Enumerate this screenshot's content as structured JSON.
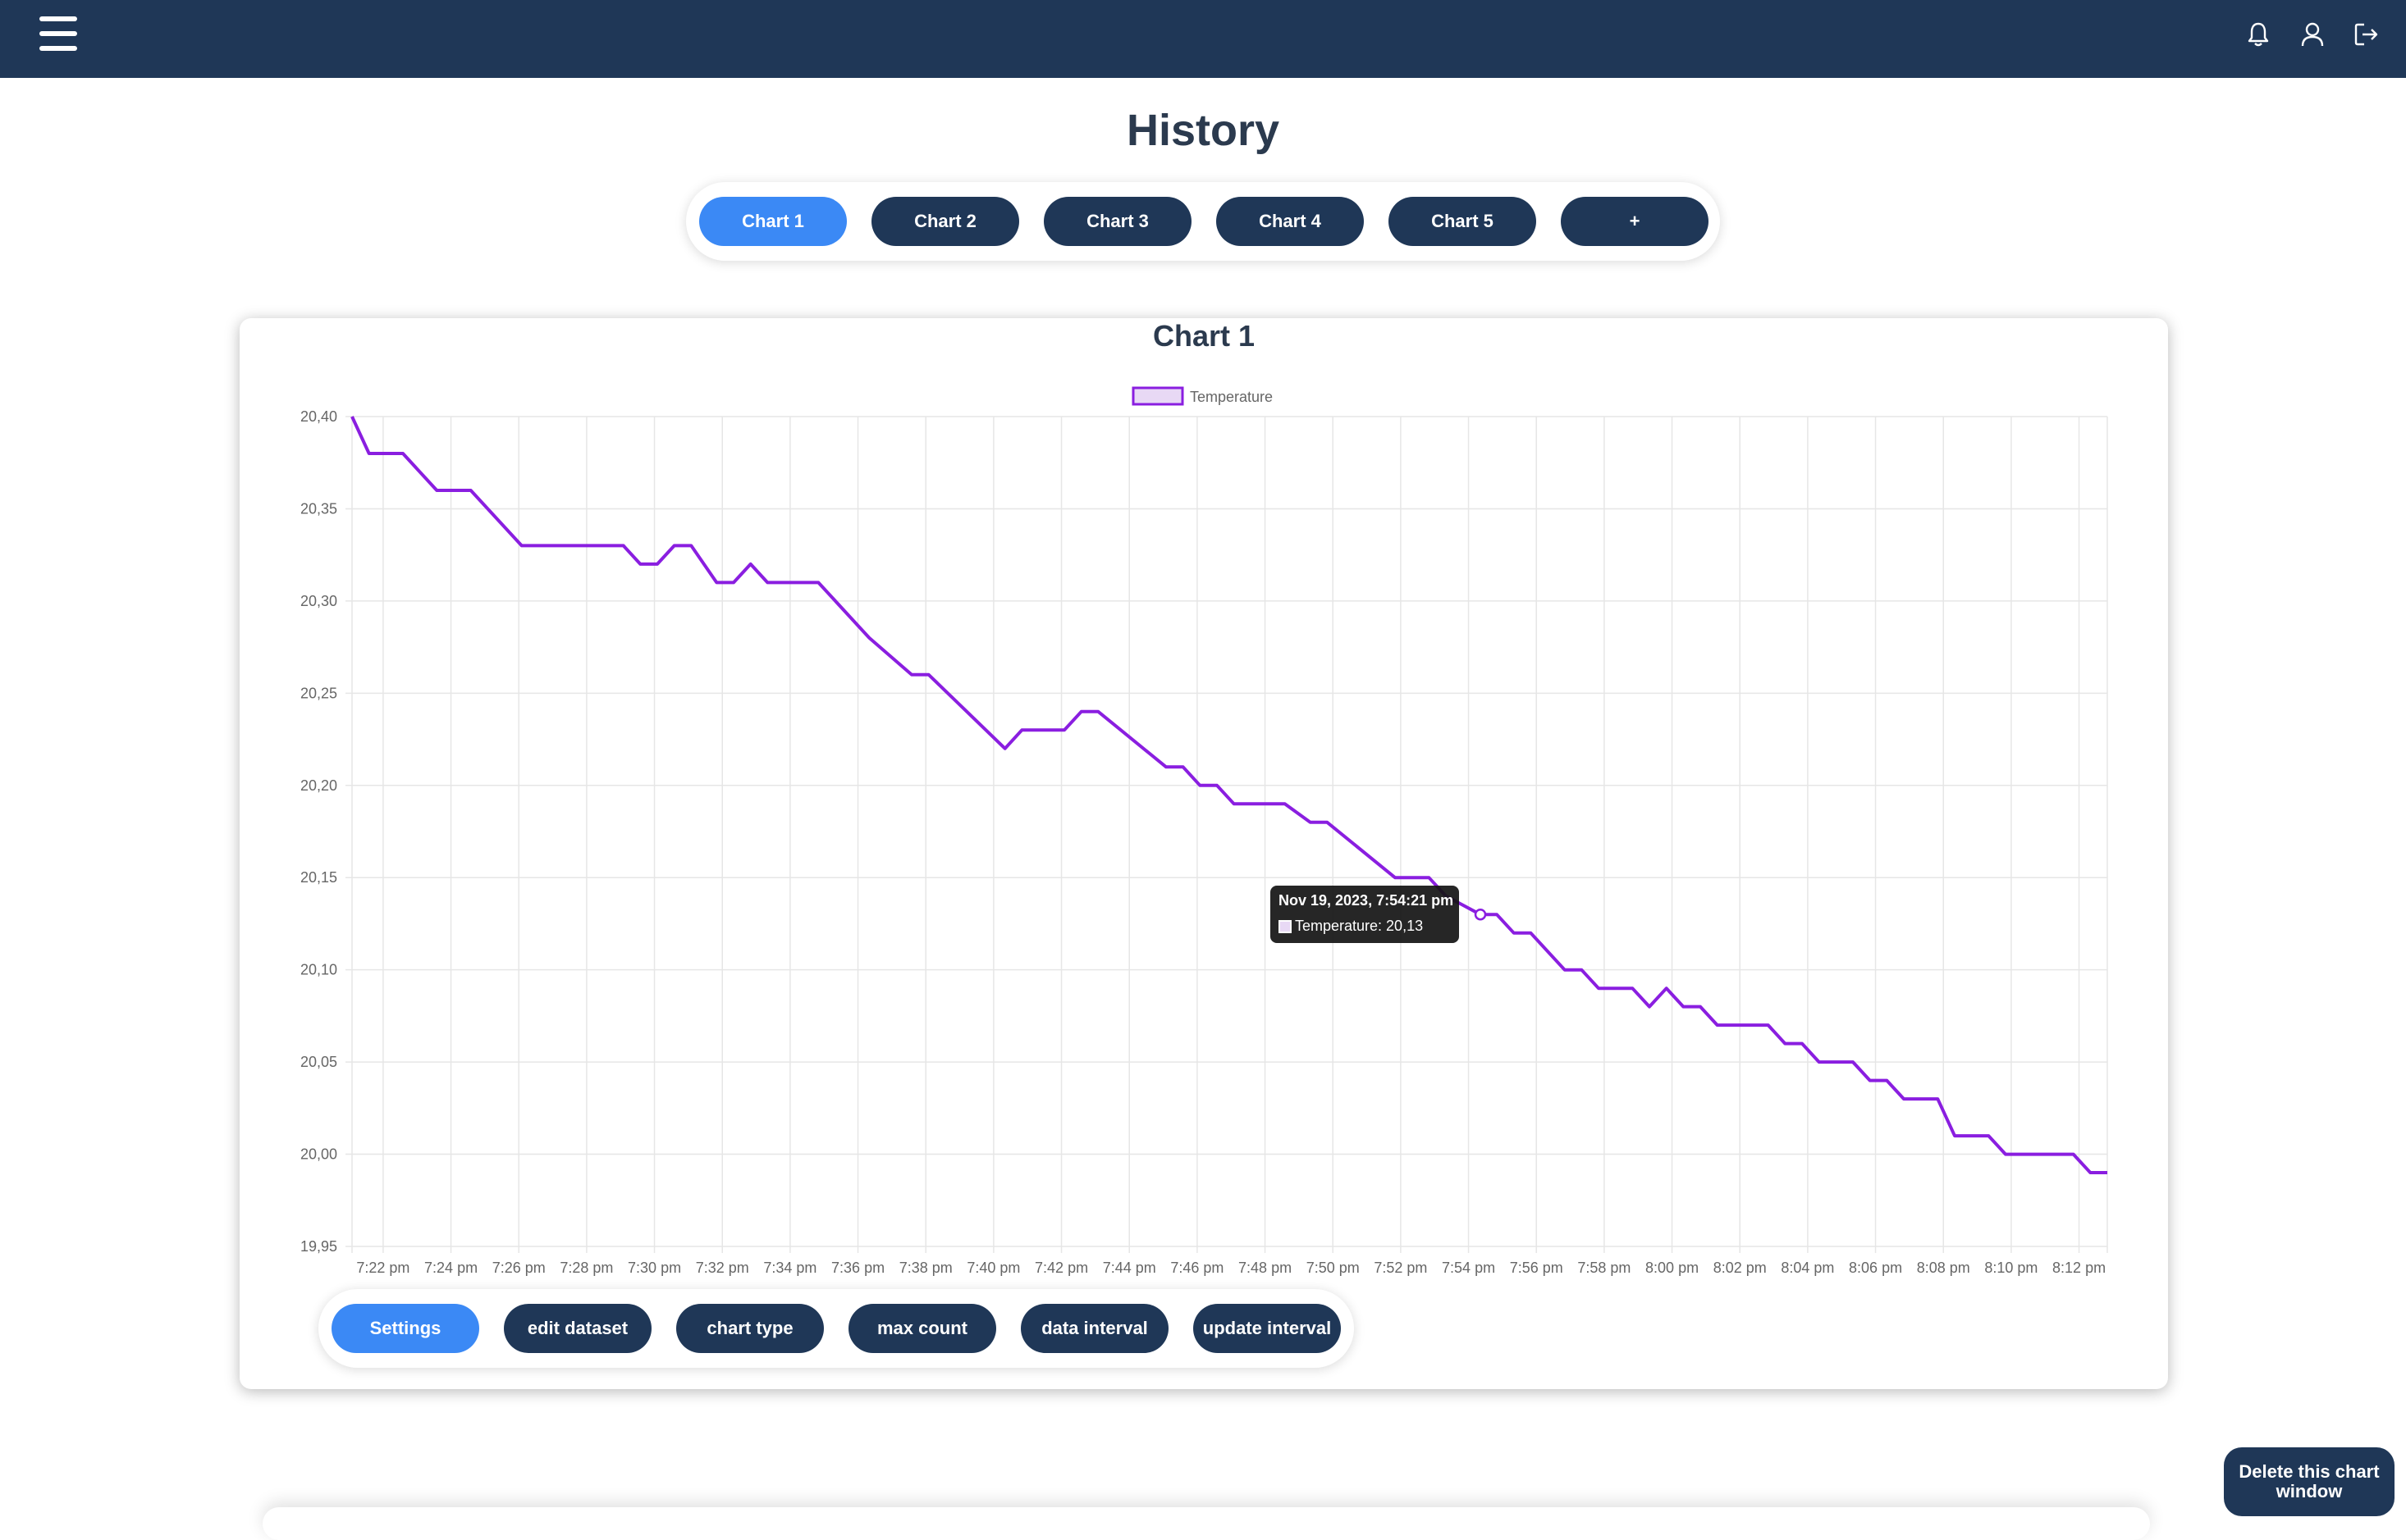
{
  "header": {
    "menu_icon": "hamburger-icon",
    "icons": [
      "bell-icon",
      "user-icon",
      "logout-icon"
    ]
  },
  "page": {
    "title": "History"
  },
  "tabs": [
    {
      "label": "Chart 1",
      "active": true
    },
    {
      "label": "Chart 2",
      "active": false
    },
    {
      "label": "Chart 3",
      "active": false
    },
    {
      "label": "Chart 4",
      "active": false
    },
    {
      "label": "Chart 5",
      "active": false
    },
    {
      "label": "+",
      "active": false
    }
  ],
  "card": {
    "title": "Chart 1"
  },
  "tooltip": {
    "title": "Nov 19, 2023, 7:54:21 pm",
    "label": "Temperature: 20,13"
  },
  "settings": [
    {
      "label": "Settings",
      "active": true
    },
    {
      "label": "edit dataset",
      "active": false
    },
    {
      "label": "chart type",
      "active": false
    },
    {
      "label": "max count",
      "active": false
    },
    {
      "label": "data interval",
      "active": false
    },
    {
      "label": "update interval",
      "active": false
    }
  ],
  "actions": {
    "delete_label": "Delete this chart window"
  },
  "colors": {
    "navy": "#1f3757",
    "accent": "#3b89f5",
    "line": "#8a1ee0"
  },
  "chart_data": {
    "type": "line",
    "title": "Chart 1",
    "legend": {
      "position": "top",
      "entries": [
        "Temperature"
      ]
    },
    "ylim": [
      19.95,
      20.4
    ],
    "yticks": [
      "20,40",
      "20,35",
      "20,30",
      "20,25",
      "20,20",
      "20,15",
      "20,10",
      "20,05",
      "20,00",
      "19,95"
    ],
    "xticks": [
      "7:22 pm",
      "7:24 pm",
      "7:26 pm",
      "7:28 pm",
      "7:30 pm",
      "7:32 pm",
      "7:34 pm",
      "7:36 pm",
      "7:38 pm",
      "7:40 pm",
      "7:42 pm",
      "7:44 pm",
      "7:46 pm",
      "7:48 pm",
      "7:50 pm",
      "7:52 pm",
      "7:54 pm",
      "7:56 pm",
      "7:58 pm",
      "8:00 pm",
      "8:02 pm",
      "8:04 pm",
      "8:06 pm",
      "8:08 pm",
      "8:10 pm",
      "8:12 pm"
    ],
    "grid": true,
    "series": [
      {
        "name": "Temperature",
        "color": "#8a1ee0",
        "points": [
          [
            "7:21:05 pm",
            20.4
          ],
          [
            "7:21:35 pm",
            20.38
          ],
          [
            "7:22:35 pm",
            20.38
          ],
          [
            "7:23:35 pm",
            20.36
          ],
          [
            "7:24:35 pm",
            20.36
          ],
          [
            "7:26:05 pm",
            20.33
          ],
          [
            "7:29:05 pm",
            20.33
          ],
          [
            "7:29:35 pm",
            20.32
          ],
          [
            "7:30:05 pm",
            20.32
          ],
          [
            "7:30:35 pm",
            20.33
          ],
          [
            "7:31:05 pm",
            20.33
          ],
          [
            "7:31:50 pm",
            20.31
          ],
          [
            "7:32:20 pm",
            20.31
          ],
          [
            "7:32:50 pm",
            20.32
          ],
          [
            "7:33:20 pm",
            20.31
          ],
          [
            "7:34:50 pm",
            20.31
          ],
          [
            "7:36:20 pm",
            20.28
          ],
          [
            "7:37:35 pm",
            20.26
          ],
          [
            "7:38:05 pm",
            20.26
          ],
          [
            "7:40:20 pm",
            20.22
          ],
          [
            "7:40:50 pm",
            20.23
          ],
          [
            "7:42:05 pm",
            20.23
          ],
          [
            "7:42:35 pm",
            20.24
          ],
          [
            "7:43:05 pm",
            20.24
          ],
          [
            "7:45:05 pm",
            20.21
          ],
          [
            "7:45:35 pm",
            20.21
          ],
          [
            "7:46:05 pm",
            20.2
          ],
          [
            "7:46:35 pm",
            20.2
          ],
          [
            "7:47:05 pm",
            20.19
          ],
          [
            "7:48:35 pm",
            20.19
          ],
          [
            "7:49:20 pm",
            20.18
          ],
          [
            "7:49:50 pm",
            20.18
          ],
          [
            "7:51:50 pm",
            20.15
          ],
          [
            "7:52:50 pm",
            20.15
          ],
          [
            "7:53:20 pm",
            20.14
          ],
          [
            "7:54:21 pm",
            20.13
          ],
          [
            "7:54:50 pm",
            20.13
          ],
          [
            "7:55:20 pm",
            20.12
          ],
          [
            "7:55:50 pm",
            20.12
          ],
          [
            "7:56:50 pm",
            20.1
          ],
          [
            "7:57:20 pm",
            20.1
          ],
          [
            "7:57:50 pm",
            20.09
          ],
          [
            "7:58:50 pm",
            20.09
          ],
          [
            "7:59:20 pm",
            20.08
          ],
          [
            "7:59:50 pm",
            20.09
          ],
          [
            "8:00:20 pm",
            20.08
          ],
          [
            "8:00:50 pm",
            20.08
          ],
          [
            "8:01:20 pm",
            20.07
          ],
          [
            "8:02:50 pm",
            20.07
          ],
          [
            "8:03:20 pm",
            20.06
          ],
          [
            "8:03:50 pm",
            20.06
          ],
          [
            "8:04:20 pm",
            20.05
          ],
          [
            "8:05:20 pm",
            20.05
          ],
          [
            "8:05:50 pm",
            20.04
          ],
          [
            "8:06:20 pm",
            20.04
          ],
          [
            "8:06:50 pm",
            20.03
          ],
          [
            "8:07:50 pm",
            20.03
          ],
          [
            "8:08:20 pm",
            20.01
          ],
          [
            "8:09:20 pm",
            20.01
          ],
          [
            "8:09:50 pm",
            20.0
          ],
          [
            "8:11:50 pm",
            20.0
          ],
          [
            "8:12:20 pm",
            19.99
          ],
          [
            "8:12:50 pm",
            19.99
          ]
        ]
      }
    ]
  }
}
